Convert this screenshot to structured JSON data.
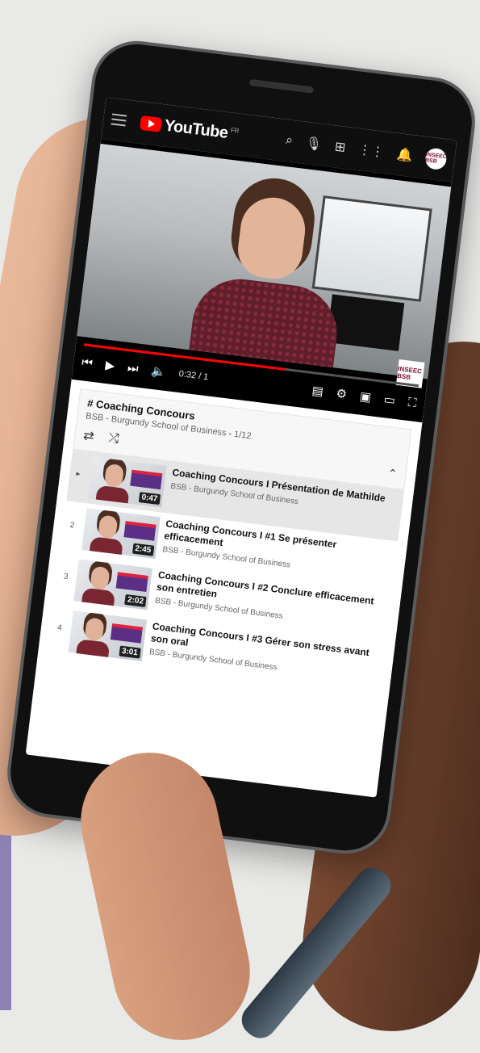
{
  "youtube": {
    "logo_text": "YouTube",
    "region": "FR",
    "channel_avatar": "INSEEC BSB",
    "icons": [
      "menu-icon",
      "search-icon",
      "mic-icon",
      "create-icon",
      "apps-icon",
      "bell-icon"
    ]
  },
  "player": {
    "time": "0:32 / 1",
    "progress": 0.6,
    "watermark": "INSEEC BSB"
  },
  "playlist": {
    "title": "# Coaching Concours",
    "channel": "BSB - Burgundy School of Business",
    "position": "1/12",
    "items": [
      {
        "index": "▸",
        "title": "Coaching Concours I Présentation de Mathilde",
        "channel": "BSB - Burgundy School of Business",
        "duration": "0:47"
      },
      {
        "index": "2",
        "title": "Coaching Concours I #1 Se présenter efficacement",
        "channel": "BSB - Burgundy School of Business",
        "duration": "2:45"
      },
      {
        "index": "3",
        "title": "Coaching Concours I #2 Conclure efficacement son entretien",
        "channel": "BSB - Burgundy School of Business",
        "duration": "2:02"
      },
      {
        "index": "4",
        "title": "Coaching Concours I #3 Gérer son stress avant son oral",
        "channel": "BSB - Burgundy School of Business",
        "duration": "3:01"
      }
    ]
  }
}
